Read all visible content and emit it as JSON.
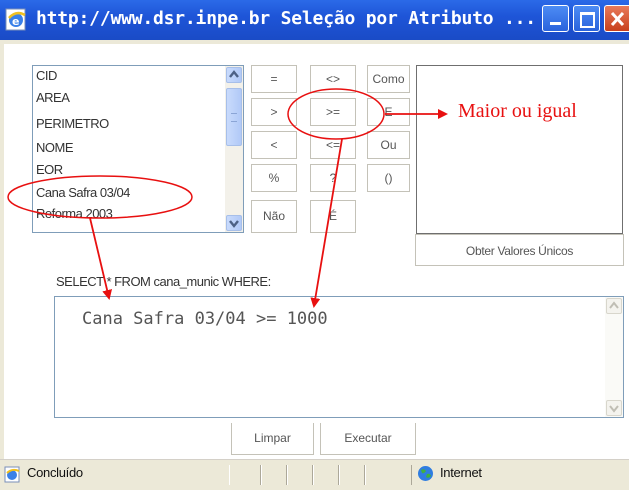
{
  "window": {
    "title": "http://www.dsr.inpe.br  Seleção por Atributo  ..."
  },
  "attributes": {
    "items": [
      "CID",
      "AREA",
      "PERIMETRO",
      "NOME",
      "EOR",
      "Cana Safra 03/04",
      "Reforma 2003"
    ],
    "selected": "Cana Safra 03/04"
  },
  "operators": [
    {
      "key": "eq",
      "label": "="
    },
    {
      "key": "ne",
      "label": "<>"
    },
    {
      "key": "like",
      "label": "Como"
    },
    {
      "key": "gt",
      "label": ">"
    },
    {
      "key": "ge",
      "label": ">="
    },
    {
      "key": "and",
      "label": "E"
    },
    {
      "key": "lt",
      "label": "<"
    },
    {
      "key": "le",
      "label": "<="
    },
    {
      "key": "or",
      "label": "Ou"
    },
    {
      "key": "pct",
      "label": "%"
    },
    {
      "key": "qmark",
      "label": "?"
    },
    {
      "key": "parens",
      "label": "()"
    },
    {
      "key": "not",
      "label": "Não"
    },
    {
      "key": "is",
      "label": "É"
    }
  ],
  "values_panel": {
    "get_values_label": "Obter Valores Únicos"
  },
  "query": {
    "label": "SELECT * FROM cana_munic WHERE:",
    "text": "Cana Safra 03/04 >= 1000"
  },
  "actions": {
    "clear_label": "Limpar",
    "execute_label": "Executar"
  },
  "statusbar": {
    "status": "Concluído",
    "zone": "Internet"
  },
  "annotation": {
    "text": "Maior ou igual",
    "color": "#e81010"
  },
  "icons": {
    "title": "ie-page-icon",
    "status": "ie-page-icon",
    "zone": "globe-icon"
  }
}
